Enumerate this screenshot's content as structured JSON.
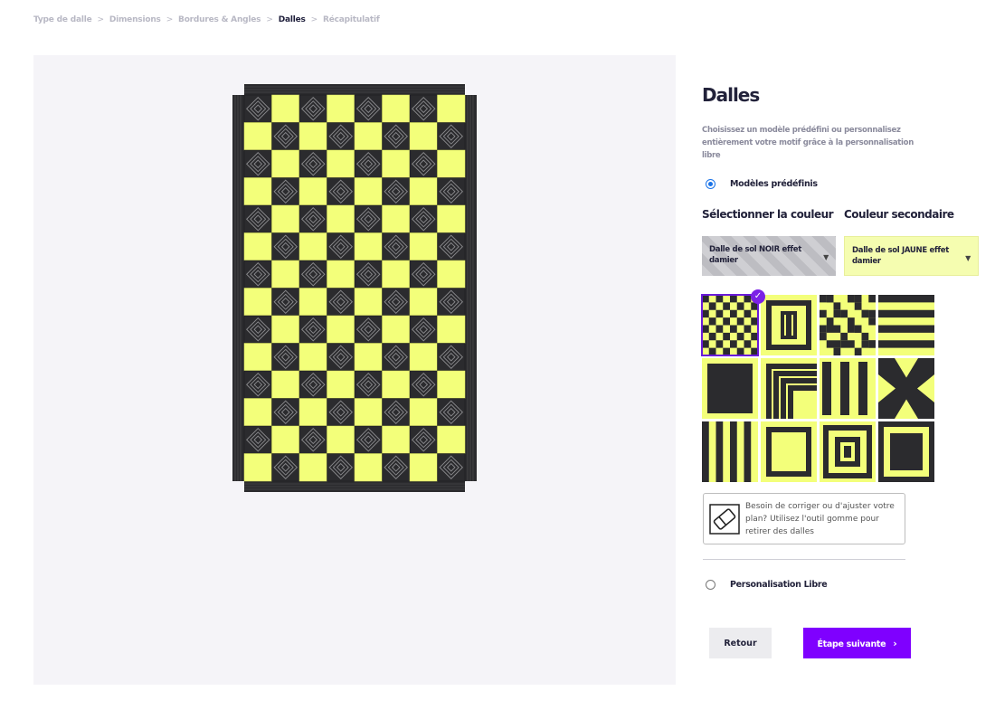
{
  "breadcrumb": {
    "items": [
      "Type de dalle",
      "Dimensions",
      "Bordures & Angles",
      "Dalles",
      "Récapitulatif"
    ],
    "separator": ">",
    "active_index": 3
  },
  "panel": {
    "title": "Dalles",
    "description": "Choisissez un modèle prédéfini ou personnalisez entièrement votre motif grâce à la personnalisation libre",
    "option_predefined": "Modèles prédéfinis",
    "option_predefined_checked": true,
    "primary_color_label": "Sélectionner la couleur",
    "secondary_color_label": "Couleur secondaire",
    "primary_color_value": "Dalle de sol NOIR effet damier",
    "secondary_color_value": "Dalle de sol JAUNE effet damier",
    "eraser_text": "Besoin de corriger ou d'ajuster votre plan? Utilisez l'outil gomme pour retirer des dalles",
    "option_free": "Personalisation Libre",
    "option_free_checked": false,
    "back_label": "Retour",
    "next_label": "Étape suivante",
    "next_icon": "chevron-right-icon"
  },
  "patterns": [
    {
      "name": "checkerboard",
      "selected": true
    },
    {
      "name": "frame-bar",
      "selected": false
    },
    {
      "name": "diagonal-stripes",
      "selected": false
    },
    {
      "name": "horizontal-stripes",
      "selected": false
    },
    {
      "name": "black-square",
      "selected": false
    },
    {
      "name": "corner-lines",
      "selected": false
    },
    {
      "name": "vertical-bars",
      "selected": false
    },
    {
      "name": "x-cross",
      "selected": false
    },
    {
      "name": "vertical-stripes",
      "selected": false
    },
    {
      "name": "hollow-square",
      "selected": false
    },
    {
      "name": "concentric-squares",
      "selected": false
    },
    {
      "name": "yellow-border-square",
      "selected": false
    }
  ],
  "floor": {
    "columns": 8,
    "rows": 14,
    "pattern": "checkerboard"
  },
  "colors": {
    "black_tile": "#2b2b2e",
    "yellow_tile": "#f3ff7a",
    "accent": "#7f00ff",
    "canvas_bg": "#f5f4f8"
  }
}
